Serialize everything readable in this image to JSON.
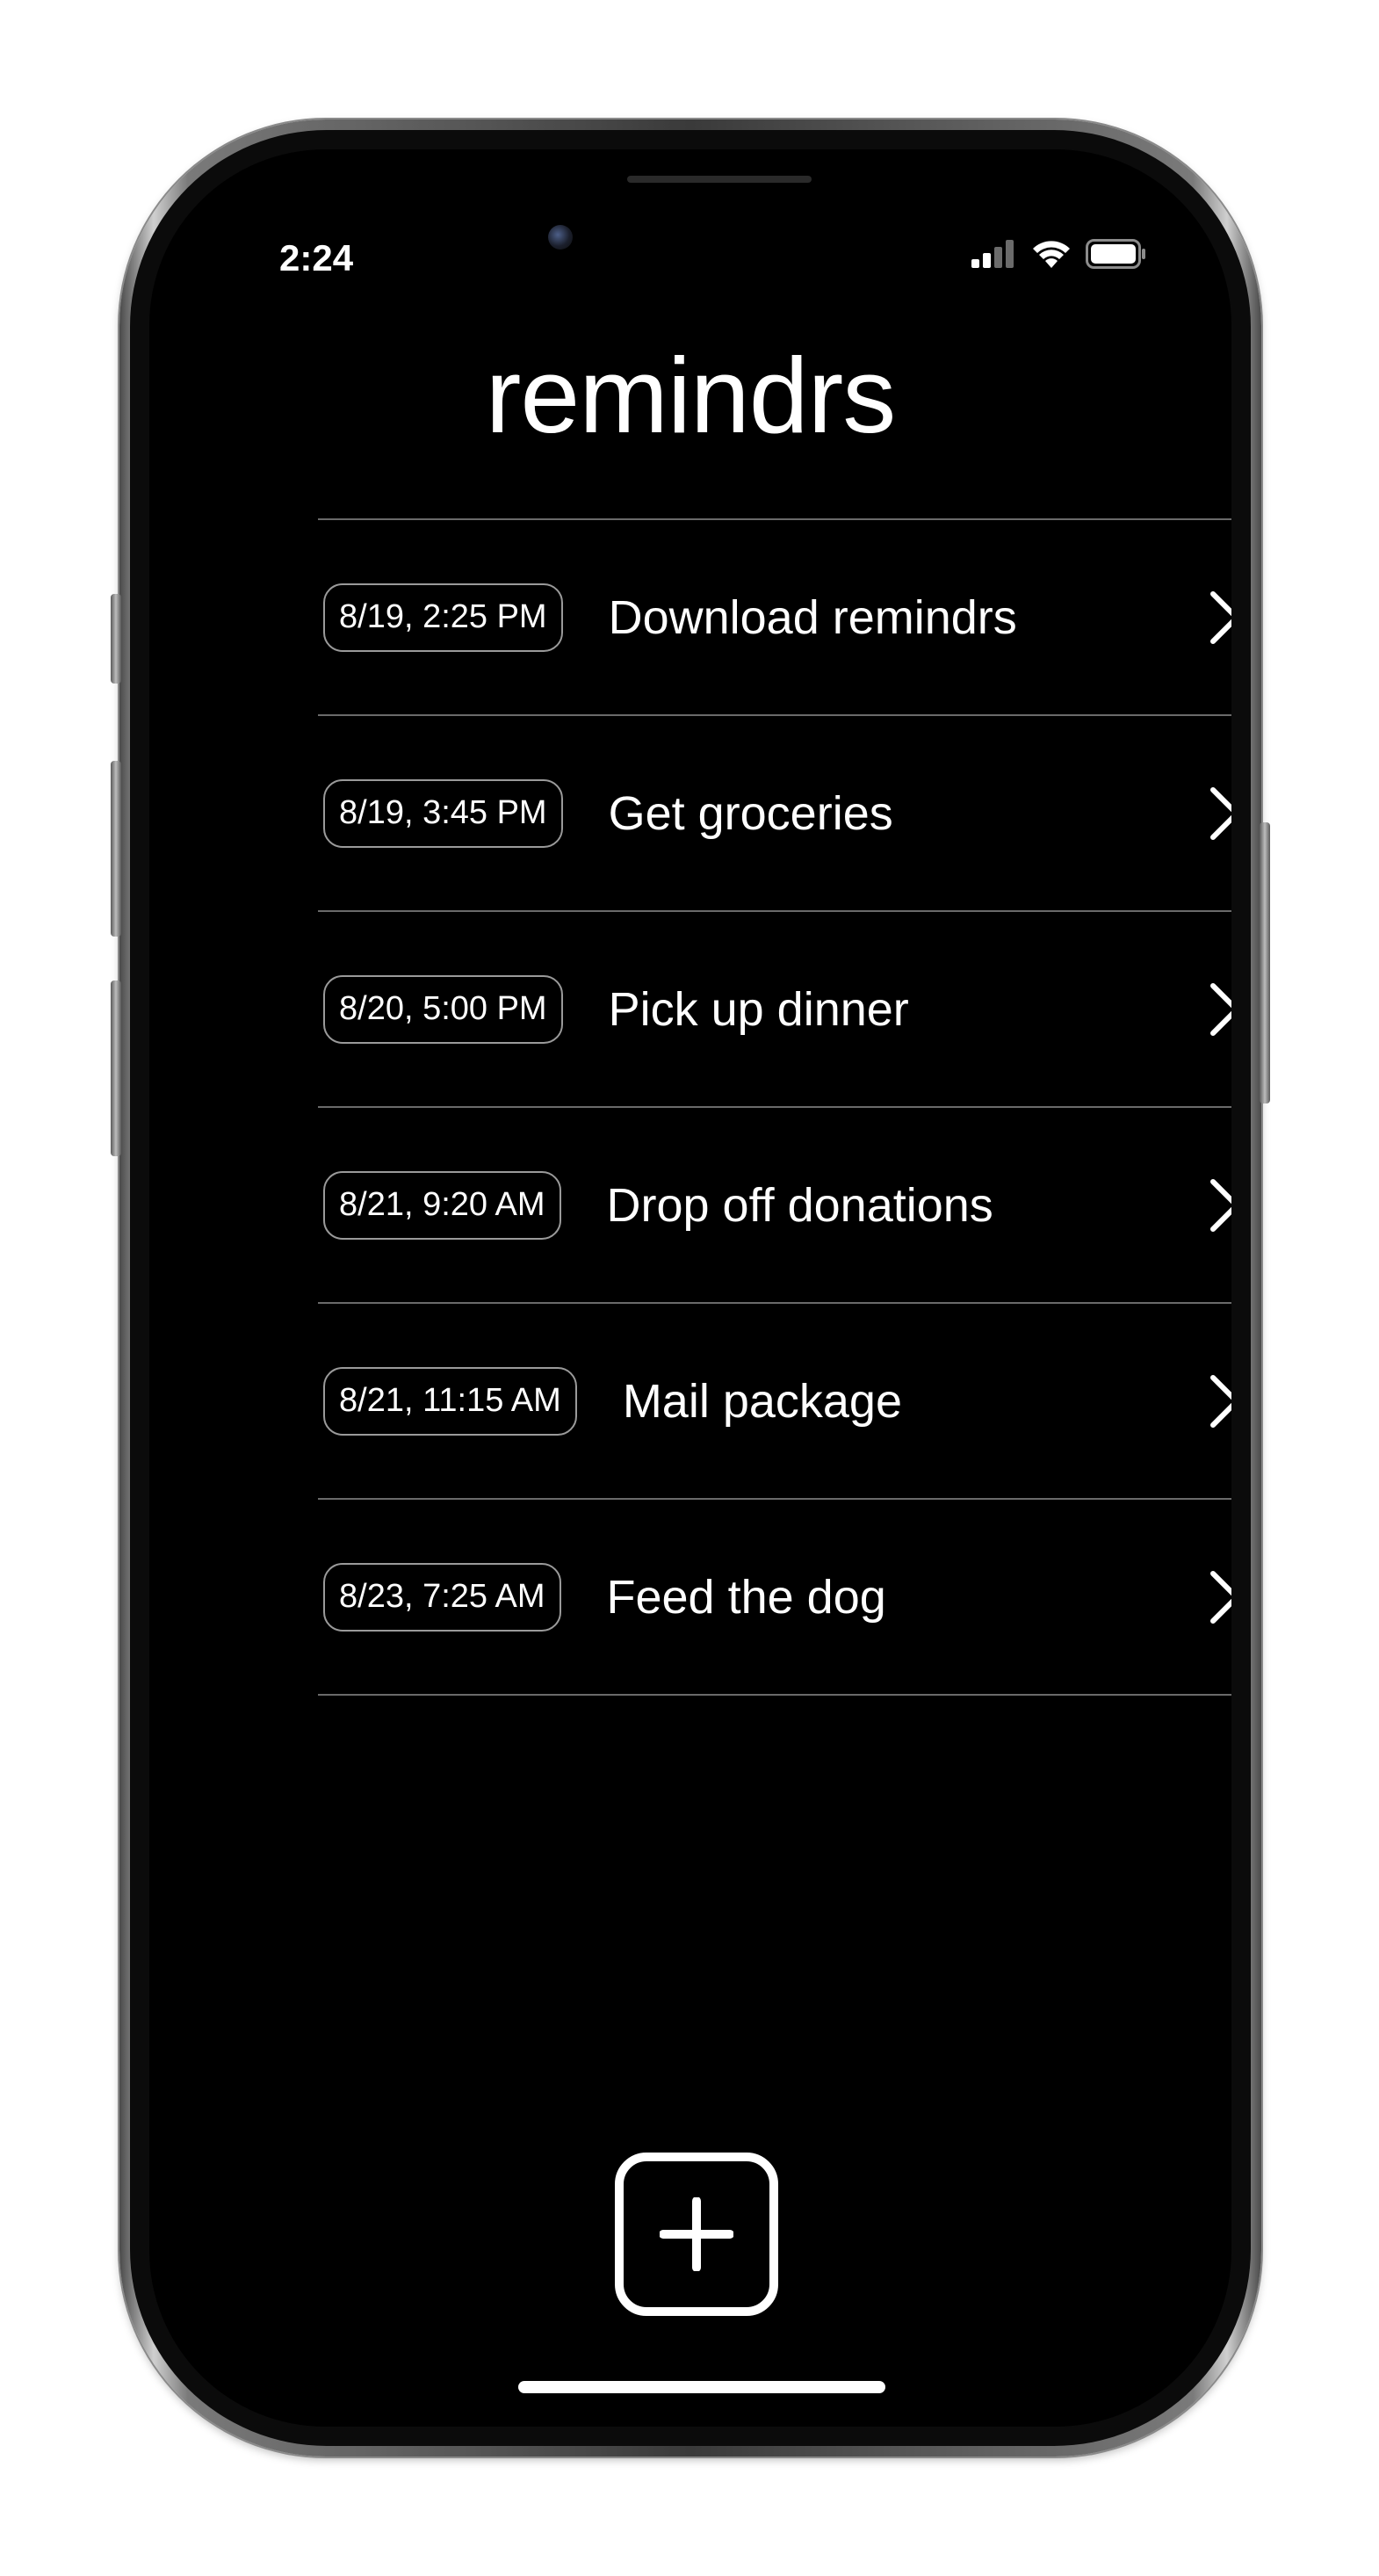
{
  "status_bar": {
    "time": "2:24",
    "icons": [
      "cellular-signal-icon",
      "wifi-icon",
      "battery-icon"
    ]
  },
  "app": {
    "title": "remindrs"
  },
  "reminders": [
    {
      "time": "8/19, 2:25 PM",
      "title": "Download remindrs"
    },
    {
      "time": "8/19, 3:45 PM",
      "title": "Get groceries"
    },
    {
      "time": "8/20, 5:00 PM",
      "title": "Pick up dinner"
    },
    {
      "time": "8/21, 9:20 AM",
      "title": "Drop off donations"
    },
    {
      "time": "8/21, 11:15 AM",
      "title": "Mail package"
    },
    {
      "time": "8/23, 7:25 AM",
      "title": "Feed the dog"
    }
  ],
  "actions": {
    "add_icon": "plus-square-icon",
    "delete_icon": "close-icon"
  },
  "colors": {
    "background": "#000000",
    "foreground": "#ffffff",
    "divider": "#6a6a6a"
  }
}
